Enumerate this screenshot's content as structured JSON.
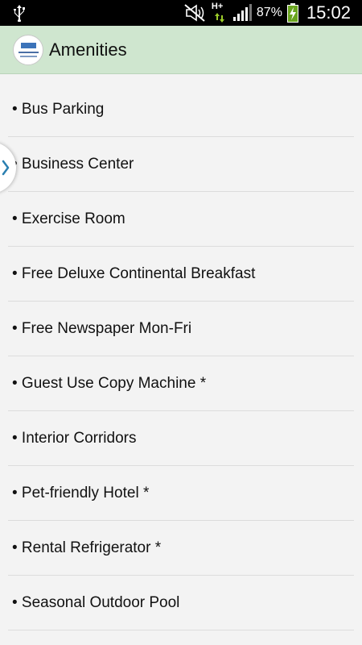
{
  "status_bar": {
    "battery_percent": "87%",
    "time": "15:02",
    "network": "H+",
    "icons": [
      "usb-icon",
      "mute-icon",
      "hplus-data-icon",
      "signal-icon",
      "battery-charging-icon"
    ]
  },
  "action_bar": {
    "title": "Amenities",
    "logo_icon": "hotel-logo-icon",
    "background": "#cfe6cf"
  },
  "amenities": [
    "• Bus Parking",
    "• Business Center",
    "• Exercise Room",
    "• Free Deluxe Continental Breakfast",
    "• Free Newspaper Mon-Fri",
    "• Guest Use Copy Machine *",
    "• Interior Corridors",
    "• Pet-friendly Hotel *",
    "• Rental Refrigerator *",
    "• Seasonal Outdoor Pool"
  ],
  "drawer_handle": {
    "icon": "chevron-right-icon",
    "accent": "#2a7fb0"
  }
}
